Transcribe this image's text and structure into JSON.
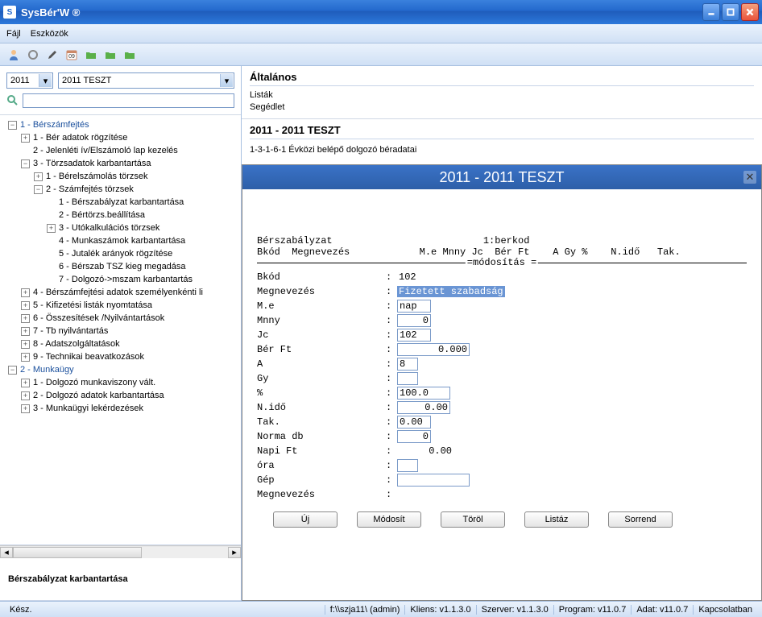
{
  "window": {
    "title": "SysBér'W ®"
  },
  "menu": {
    "file": "Fájl",
    "tools": "Eszközök"
  },
  "selectors": {
    "year": "2011",
    "company": "2011 TESZT",
    "search_placeholder": ""
  },
  "tree": {
    "n1": "1 - Bérszámfejtés",
    "n1_1": "1 - Bér adatok rögzítése",
    "n1_2": "2 - Jelenléti ív/Elszámoló lap kezelés",
    "n1_3": "3 - Törzsadatok karbantartása",
    "n1_3_1": "1 - Bérelszámolás törzsek",
    "n1_3_2": "2 - Számfejtés törzsek",
    "n1_3_2_1": "1 - Bérszabályzat karbantartása",
    "n1_3_2_2": "2 - Bértörzs.beállítása",
    "n1_3_2_3": "3 - Utókalkulációs törzsek",
    "n1_3_2_4": "4 - Munkaszámok karbantartása",
    "n1_3_2_5": "5 - Jutalék arányok rögzítése",
    "n1_3_2_6": "6 - Bérszab TSZ kieg megadása",
    "n1_3_2_7": "7 - Dolgozó->mszam karbantartás",
    "n1_4": "4 - Bérszámfejtési adatok személyenkénti li",
    "n1_5": "5 - Kifizetési listák nyomtatása",
    "n1_6": "6 - Összesítések /Nyilvántartások",
    "n1_7": "7 - Tb nyilvántartás",
    "n1_8": "8 - Adatszolgáltatások",
    "n1_9": "9 - Technikai beavatkozások",
    "n2": "2 - Munkaügy",
    "n2_1": "1 - Dolgozó munkaviszony vált.",
    "n2_2": "2 - Dolgozó adatok karbantartása",
    "n2_3": "3 - Munkaügyi lekérdezések"
  },
  "context_label": "Bérszabályzat karbantartása",
  "right": {
    "general_title": "Általános",
    "link_lists": "Listák",
    "link_help": "Segédlet",
    "session_title": "2011 - 2011 TESZT",
    "history1": "1-3-1-6-1 Évközi belépő dolgozó béradatai"
  },
  "form": {
    "title": "2011 - 2011 TESZT",
    "header_line1": "Bérszabályzat                          1:berkod",
    "header_line2": "Bkód  Megnevezés            M.e Mnny Jc  Bér Ft    A Gy %    N.idő   Tak.",
    "divider_label": "=módosítás =",
    "fields": {
      "bkod_label": "Bkód",
      "bkod_value": "102",
      "megnev_label": "Megnevezés",
      "megnev_value": "Fizetett szabadság",
      "me_label": "M.e",
      "me_value": "nap",
      "mnny_label": "Mnny",
      "mnny_value": "0",
      "jc_label": "Jc",
      "jc_value": "102",
      "berft_label": "Bér Ft",
      "berft_value": "0.000",
      "a_label": "A",
      "a_value": "8",
      "gy_label": "Gy",
      "gy_value": "",
      "pct_label": "%",
      "pct_value": "100.0",
      "nido_label": "N.idő",
      "nido_value": "0.00",
      "tak_label": "Tak.",
      "tak_value": "0.00",
      "norma_label": "Norma db",
      "norma_value": "0",
      "napift_label": "Napi Ft",
      "napift_value": "0.00",
      "ora_label": "óra",
      "ora_value": "",
      "gep_label": "Gép",
      "gep_value": "",
      "megnev2_label": "Megnevezés",
      "megnev2_value": ""
    },
    "buttons": {
      "new": "Új",
      "modify": "Módosít",
      "delete": "Töröl",
      "list": "Listáz",
      "order": "Sorrend"
    }
  },
  "status": {
    "ready": "Kész.",
    "path": "f:\\\\szja11\\ (admin)",
    "client": "Kliens: v1.1.3.0",
    "server": "Szerver: v1.1.3.0",
    "program": "Program: v11.0.7",
    "data": "Adat: v11.0.7",
    "connection": "Kapcsolatban"
  }
}
